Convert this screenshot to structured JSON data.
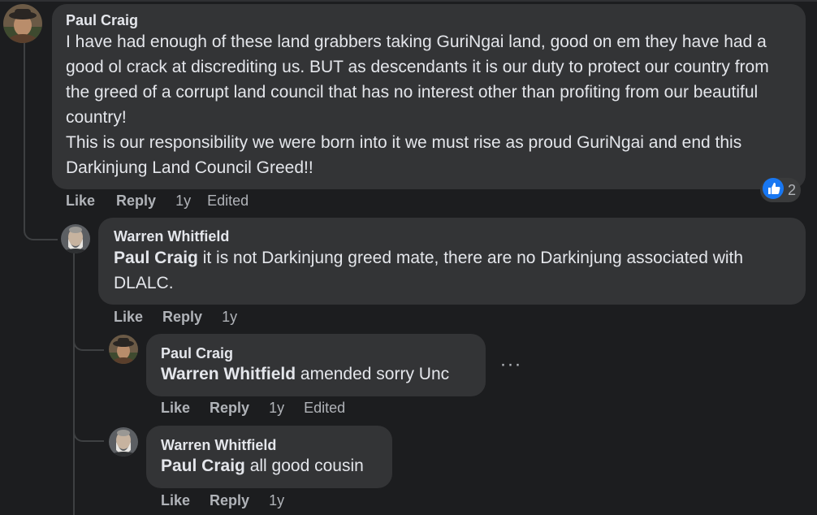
{
  "comments": [
    {
      "author": "Paul Craig",
      "text": "I have had enough of these land grabbers taking GuriNgai land, good on em they have had a good ol crack at discrediting us. BUT as descendants it is our duty to protect our country from the greed of a corrupt land council that has no interest other than profiting from our beautiful country!\nThis is our responsibility we were born into it we must rise as proud GuriNgai and end this Darkinjung Land Council Greed!!",
      "like_label": "Like",
      "reply_label": "Reply",
      "time": "1y",
      "edited": "Edited",
      "reaction_count": "2"
    },
    {
      "author": "Warren Whitfield",
      "mention": "Paul Craig",
      "text": " it is not Darkinjung greed mate, there are no Darkinjung associated with DLALC.",
      "like_label": "Like",
      "reply_label": "Reply",
      "time": "1y"
    },
    {
      "author": "Paul Craig",
      "mention": "Warren Whitfield",
      "text": " amended sorry Unc",
      "like_label": "Like",
      "reply_label": "Reply",
      "time": "1y",
      "edited": "Edited",
      "more_label": "···"
    },
    {
      "author": "Warren Whitfield",
      "mention": "Paul Craig",
      "text": " all good cousin",
      "like_label": "Like",
      "reply_label": "Reply",
      "time": "1y"
    }
  ],
  "colors": {
    "background": "#1c1d1f",
    "bubble": "#333436",
    "text": "#e4e6eb",
    "muted": "#b0b3b8",
    "like_blue": "#1877f2"
  },
  "icons": {
    "reaction": "thumbs-up-icon",
    "more": "more-options-icon"
  }
}
